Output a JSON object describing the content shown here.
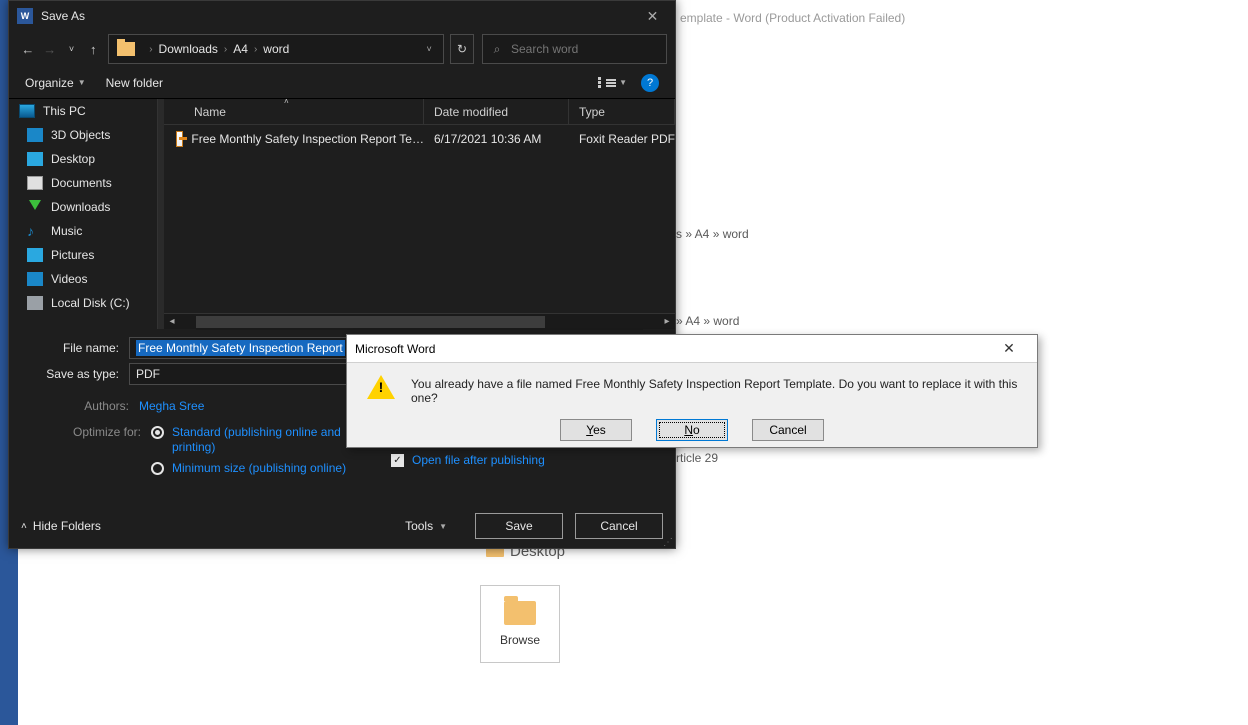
{
  "background": {
    "word_title": "emplate - Word (Product Activation Failed)",
    "crumb1": "s » A4 » word",
    "crumb2": "» A4 » word",
    "article": "rticle 29",
    "desktop_label": "Desktop",
    "browse_label": "Browse"
  },
  "saveas": {
    "title": "Save As",
    "word_icon_text": "W",
    "breadcrumb": {
      "items": [
        "Downloads",
        "A4",
        "word"
      ]
    },
    "search": {
      "placeholder": "Search word"
    },
    "toolbar": {
      "organize": "Organize",
      "new_folder": "New folder"
    },
    "tree": {
      "this_pc": "This PC",
      "items": [
        "3D Objects",
        "Desktop",
        "Documents",
        "Downloads",
        "Music",
        "Pictures",
        "Videos",
        "Local Disk (C:)"
      ]
    },
    "columns": {
      "name": "Name",
      "date": "Date modified",
      "type": "Type"
    },
    "rows": [
      {
        "name": "Free Monthly Safety Inspection Report Te…",
        "date": "6/17/2021 10:36 AM",
        "type": "Foxit Reader PDF"
      }
    ],
    "fields": {
      "file_name_label": "File name:",
      "file_name_value": "Free Monthly Safety Inspection Report",
      "save_type_label": "Save as type:",
      "save_type_value": "PDF",
      "authors_label": "Authors:",
      "authors_value": "Megha Sree",
      "optimize_label": "Optimize for:",
      "opt_standard": "Standard (publishing online and printing)",
      "opt_min": "Minimum size (publishing online)",
      "open_after": "Open file after publishing"
    },
    "footer": {
      "hide_folders": "Hide Folders",
      "tools": "Tools",
      "save": "Save",
      "cancel": "Cancel"
    }
  },
  "confirm": {
    "title": "Microsoft Word",
    "message": "You already have a file named Free Monthly Safety Inspection Report Template. Do you want to replace it with this one?",
    "yes": "es",
    "yes_u": "Y",
    "no": "o",
    "no_u": "N",
    "cancel": "Cancel"
  }
}
